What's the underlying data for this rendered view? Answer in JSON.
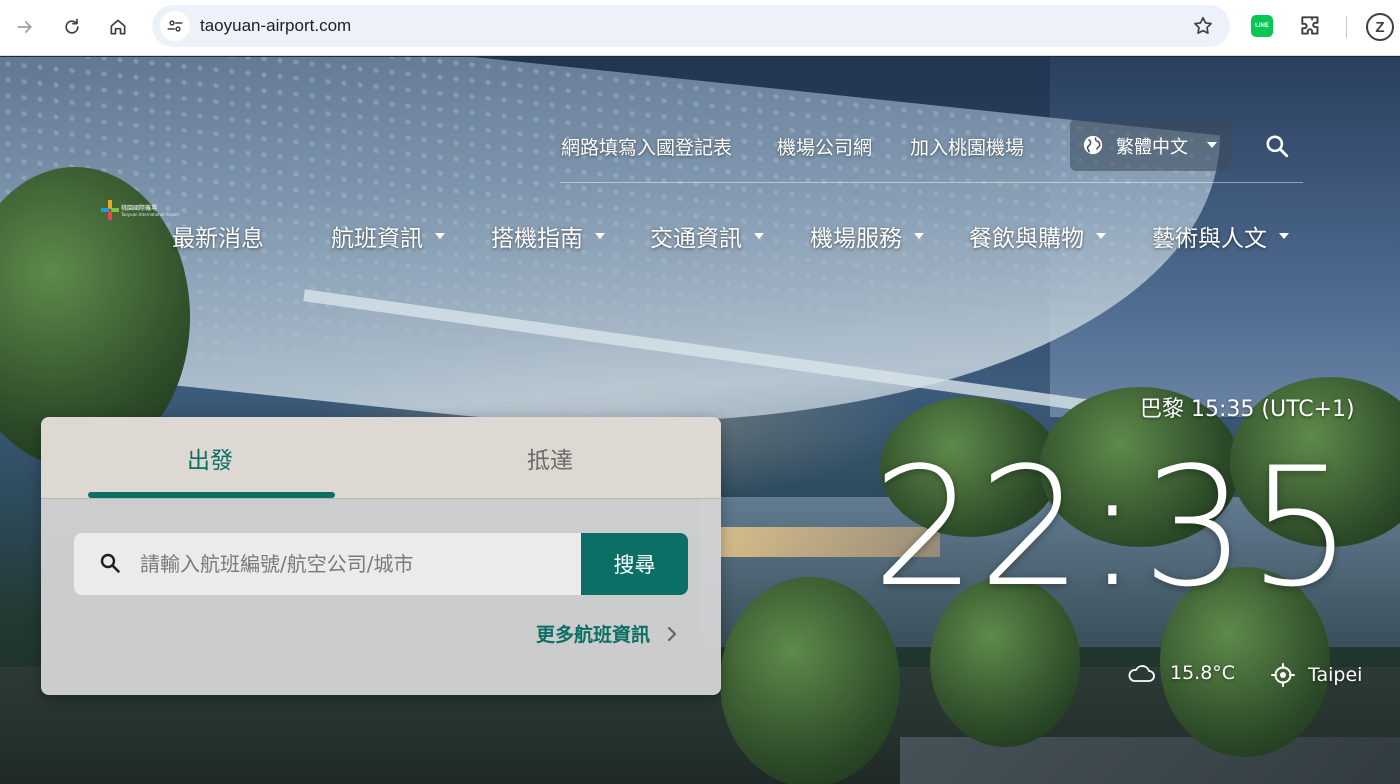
{
  "browser": {
    "url": "taoyuan-airport.com"
  },
  "header": {
    "top_links": [
      {
        "label": "網路填寫入國登記表"
      },
      {
        "label": "機場公司網"
      },
      {
        "label": "加入桃園機場"
      }
    ],
    "language": "繁體中文",
    "logo_text": "桃園國際機場",
    "logo_sub": "Taoyuan International Airport"
  },
  "main_nav": [
    {
      "label": "最新消息",
      "has_dropdown": false
    },
    {
      "label": "航班資訊",
      "has_dropdown": true
    },
    {
      "label": "搭機指南",
      "has_dropdown": true
    },
    {
      "label": "交通資訊",
      "has_dropdown": true
    },
    {
      "label": "機場服務",
      "has_dropdown": true
    },
    {
      "label": "餐飲與購物",
      "has_dropdown": true
    },
    {
      "label": "藝術與人文",
      "has_dropdown": true
    }
  ],
  "flight_panel": {
    "tabs": [
      {
        "label": "出發",
        "active": true
      },
      {
        "label": "抵達",
        "active": false
      }
    ],
    "search_placeholder": "請輸入航班編號/航空公司/城市",
    "search_button": "搜尋",
    "more_link": "更多航班資訊"
  },
  "clock": {
    "city_time": "巴黎 15:35 (UTC+1)",
    "local_time": "22:35",
    "temperature": "15.8°C",
    "location": "Taipei"
  },
  "colors": {
    "accent": "#0c6f66",
    "panel_bg": "#d6d6d6"
  },
  "icons": {
    "back": "arrow-right-icon",
    "reload": "reload-icon",
    "home": "home-icon",
    "site_info": "tune-icon",
    "bookmark": "star-icon",
    "language": "globe-icon",
    "search": "search-icon",
    "weather": "cloud-icon",
    "location": "location-target-icon"
  }
}
